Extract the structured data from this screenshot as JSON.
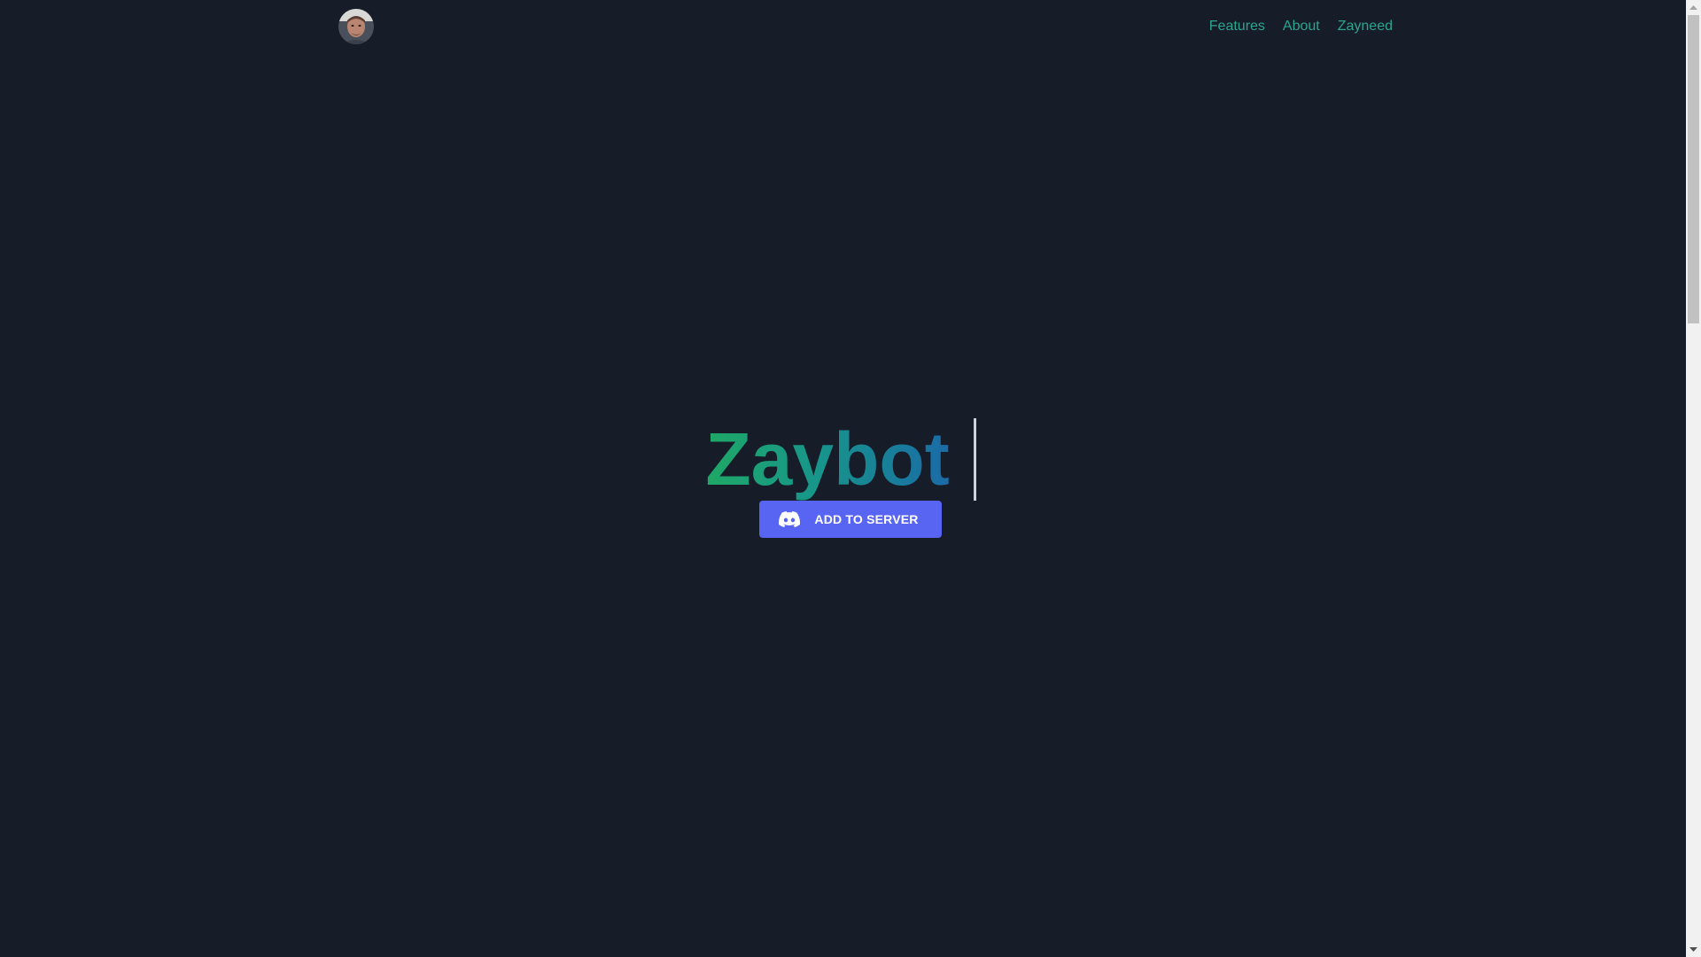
{
  "nav": {
    "avatar_icon": "user-avatar",
    "links": [
      {
        "label": "Features"
      },
      {
        "label": "About"
      },
      {
        "label": "Zayneed"
      }
    ]
  },
  "hero": {
    "title": "Zaybot",
    "button_label": "ADD TO SERVER",
    "button_icon": "discord-icon"
  },
  "colors": {
    "background": "#171c29",
    "link": "#2aa68e",
    "button": "#5865f2",
    "title_gradient_start": "#1fa865",
    "title_gradient_end": "#1a6ba7"
  }
}
